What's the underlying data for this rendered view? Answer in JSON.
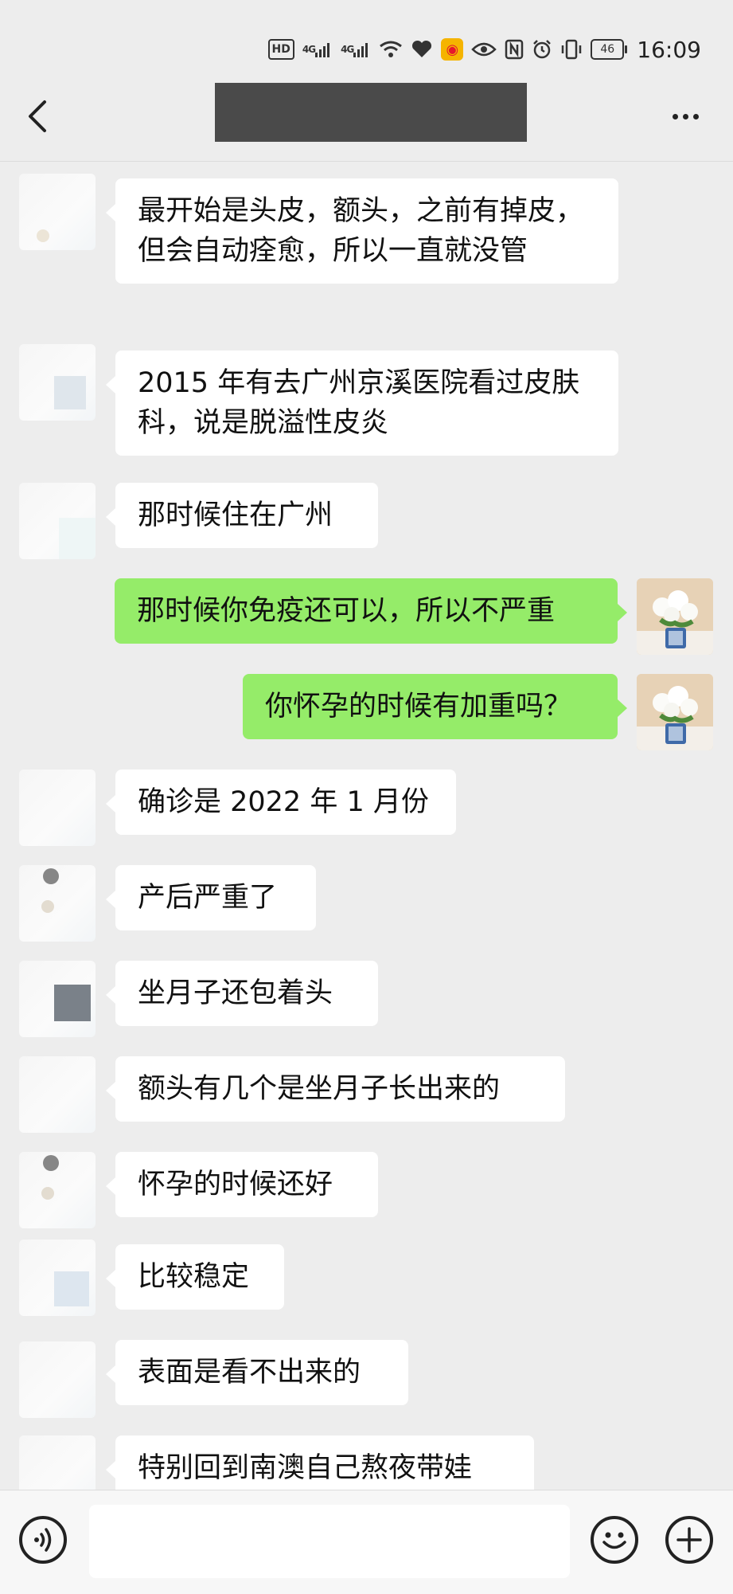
{
  "status_bar": {
    "hd": "HD",
    "signal1": "4G",
    "signal2": "4G",
    "battery": "46",
    "time": "16:09"
  },
  "header": {
    "back_icon": "chevron-left-icon",
    "more_icon": "more-dots-icon"
  },
  "messages": [
    {
      "side": "left",
      "text": "最开始是头皮，额头，之前有掉皮，但会自动痊愈，所以一直就没管"
    },
    {
      "side": "left",
      "text": "2015 年有去广州京溪医院看过皮肤科，说是脱溢性皮炎"
    },
    {
      "side": "left",
      "text": "那时候住在广州"
    },
    {
      "side": "right",
      "text": "那时候你免疫还可以，所以不严重"
    },
    {
      "side": "right",
      "text": "你怀孕的时候有加重吗？"
    },
    {
      "side": "left",
      "text": "确诊是 2022 年 1 月份"
    },
    {
      "side": "left",
      "text": "产后严重了"
    },
    {
      "side": "left",
      "text": "坐月子还包着头"
    },
    {
      "side": "left",
      "text": "额头有几个是坐月子长出来的"
    },
    {
      "side": "left",
      "text": "怀孕的时候还好"
    },
    {
      "side": "left",
      "text": "比较稳定"
    },
    {
      "side": "left",
      "text": "表面是看不出来的"
    },
    {
      "side": "left",
      "text": "特别回到南澳自己熬夜带娃"
    }
  ],
  "input_bar": {
    "voice_icon": "voice-icon",
    "emoji_icon": "emoji-icon",
    "plus_icon": "plus-icon"
  },
  "colors": {
    "background": "#ededed",
    "bubble_left": "#ffffff",
    "bubble_right": "#95ec69"
  }
}
